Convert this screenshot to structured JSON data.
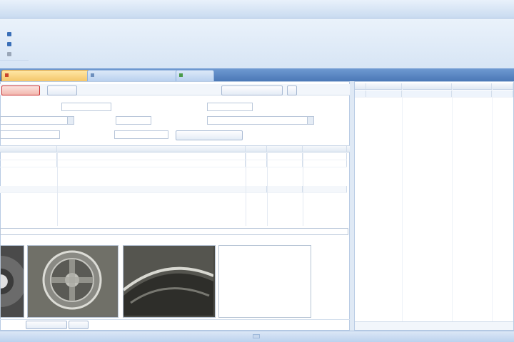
{
  "window": {
    "title": ""
  },
  "ribbon": {
    "items": [
      {
        "label": "",
        "icon": "add-icon",
        "color": "#3a6fb8"
      },
      {
        "label": "",
        "icon": "edit-icon",
        "color": "#3a6fb8"
      },
      {
        "label": "",
        "icon": "delete-icon",
        "color": "#9aa7b8"
      }
    ],
    "group_label": ""
  },
  "tabs": [
    {
      "label": "",
      "active": true
    },
    {
      "label": "",
      "active": false
    },
    {
      "label": "",
      "active": false
    }
  ],
  "form": {
    "toolbar": {
      "buttons": [
        "",
        "",
        ""
      ],
      "right_buttons": [
        "",
        ""
      ]
    },
    "fields": {
      "date_label": "",
      "date_value": "",
      "status_label": "",
      "status_value": "",
      "client_value": "",
      "model_label": "",
      "model_value": "",
      "source_label": "",
      "source_value": "",
      "phone_label": "",
      "phone_value": "",
      "action_button": ""
    },
    "grid": {
      "columns": [
        "",
        "",
        "",
        "",
        ""
      ],
      "rows": [
        [
          "",
          "",
          "",
          "",
          ""
        ],
        [
          "",
          "",
          "",
          "",
          ""
        ]
      ],
      "totals": [
        "",
        "",
        ""
      ]
    },
    "note": "",
    "photos": {
      "labels": [
        "",
        "",
        "",
        ""
      ]
    },
    "bottom_tabs": [
      "",
      ""
    ]
  },
  "side": {
    "columns": [
      "",
      "",
      "",
      "",
      ""
    ],
    "rows": [
      [
        "",
        "",
        "",
        "",
        ""
      ]
    ],
    "footer": ""
  },
  "colors": {
    "accent": "#4b78b6",
    "active_tab": "#f4c66a",
    "danger": "#c33333"
  }
}
